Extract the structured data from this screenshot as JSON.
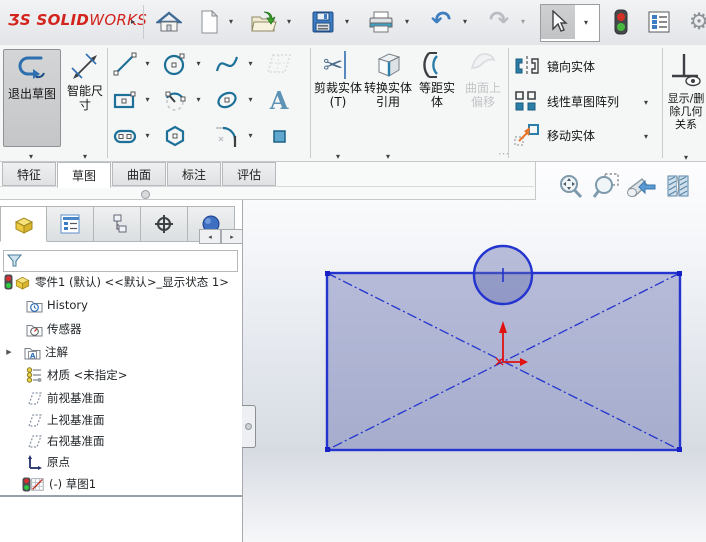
{
  "app": {
    "name": "SOLIDWORKS"
  },
  "logo": {
    "glyph": "ƷS",
    "bold": "SOLID",
    "light": "WORKS"
  },
  "icons": {
    "dropdown": "▾",
    "flyout_expander": "▸",
    "tree_caret": "▶",
    "scroll_left": "◂",
    "scroll_right": "▸",
    "gear": "⚙",
    "undo": "↶",
    "redo": "↷",
    "scissors": "✂",
    "overflow": "⋯",
    "text_tool": "A"
  },
  "top_toolbar": {
    "buttons": [
      "home",
      "new-document",
      "open",
      "save",
      "print",
      "undo",
      "redo",
      "select",
      "traffic-light",
      "options",
      "settings"
    ]
  },
  "ribbon": {
    "exit_sketch": "退出草图",
    "smart_dimension": "智能尺寸",
    "trim": "剪裁实体(T)",
    "convert": "转换实体引用",
    "offset": "等距实体",
    "offset_surface": "曲面上偏移",
    "mirror": "镜向实体",
    "linear_pattern": "线性草图阵列",
    "move": "移动实体",
    "display_relations": "显示/删除几何关系"
  },
  "tabs": [
    {
      "label": "特征",
      "active": false
    },
    {
      "label": "草图",
      "active": true
    },
    {
      "label": "曲面",
      "active": false
    },
    {
      "label": "标注",
      "active": false
    },
    {
      "label": "评估",
      "active": false
    }
  ],
  "panel": {
    "filter_placeholder": "",
    "tree": {
      "root": "零件1 (默认) <<默认>_显示状态 1>",
      "items": [
        {
          "label": "History"
        },
        {
          "label": "传感器"
        },
        {
          "label": "注解"
        },
        {
          "label": "材质 <未指定>"
        },
        {
          "label": "前视基准面"
        },
        {
          "label": "上视基准面"
        },
        {
          "label": "右视基准面"
        },
        {
          "label": "原点"
        },
        {
          "label": "(-) 草图1"
        }
      ]
    }
  },
  "colors": {
    "sketch_line": "#2334cf",
    "sketch_fill": "rgba(99,110,175,0.42)",
    "origin_red": "#e01111",
    "logo_red": "#d2231c",
    "tool_blue": "#1d7199"
  }
}
